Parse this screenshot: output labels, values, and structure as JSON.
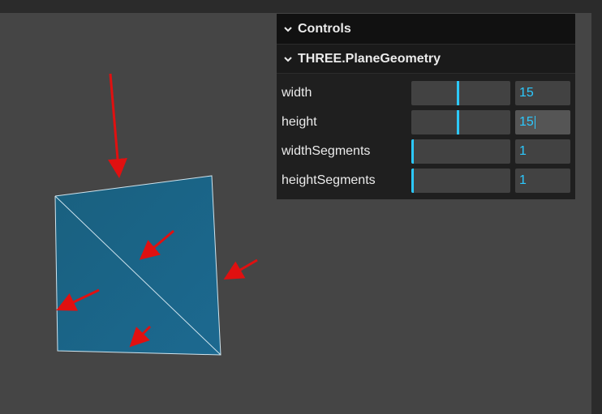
{
  "gui": {
    "title": "Controls",
    "folder": {
      "title": "THREE.PlaneGeometry",
      "controls": [
        {
          "label": "width",
          "value": "15",
          "level": 0.47,
          "focused": false
        },
        {
          "label": "height",
          "value": "15",
          "level": 0.47,
          "focused": true
        },
        {
          "label": "widthSegments",
          "value": "1",
          "level": 0.0,
          "focused": false
        },
        {
          "label": "heightSegments",
          "value": "1",
          "level": 0.0,
          "focused": false
        }
      ]
    }
  },
  "colors": {
    "accent": "#2cc9ff",
    "plane_fill": "#1b6488",
    "plane_edges": "#cfe4ee",
    "annotation_arrows": "#e01010",
    "background": "#454545"
  },
  "icons": {
    "collapse": "chevron-down-icon"
  }
}
